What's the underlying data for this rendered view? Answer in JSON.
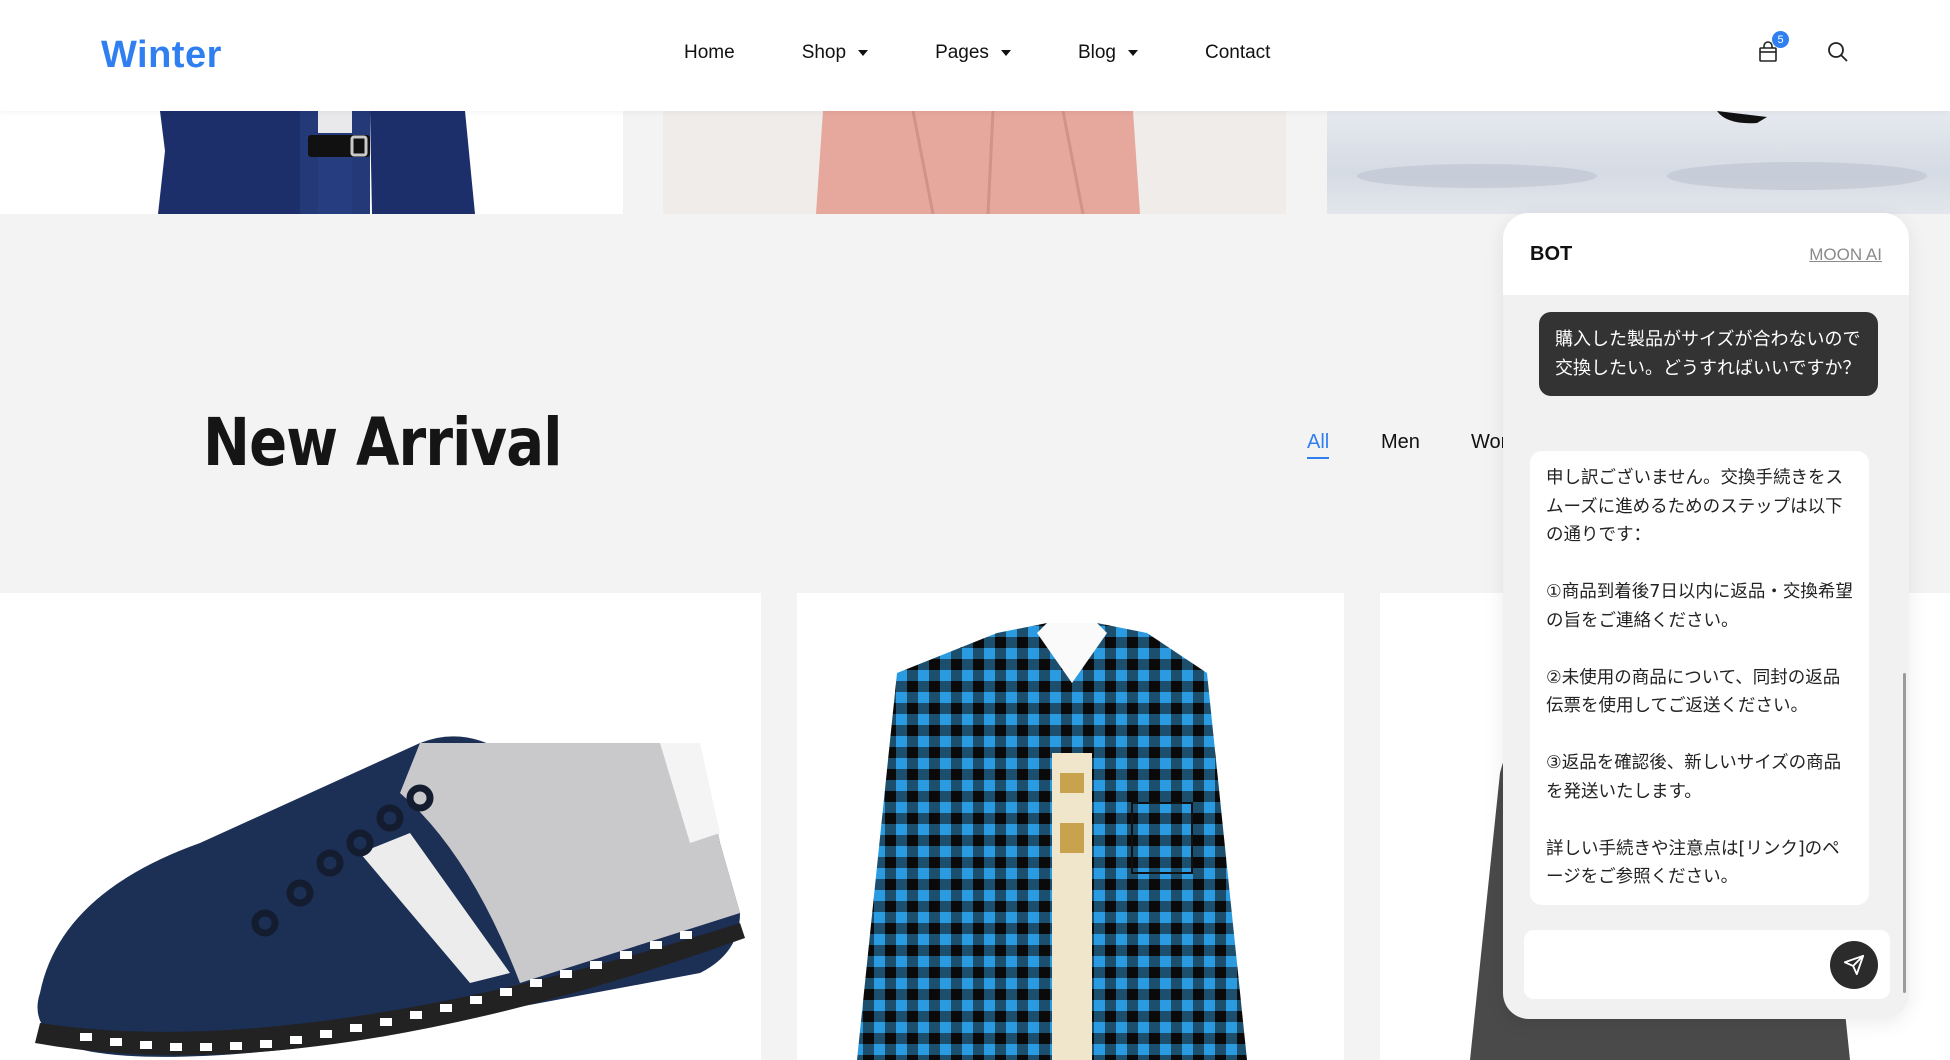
{
  "header": {
    "logo": "Winter",
    "nav": [
      {
        "label": "Home",
        "has_dropdown": false
      },
      {
        "label": "Shop",
        "has_dropdown": true
      },
      {
        "label": "Pages",
        "has_dropdown": true
      },
      {
        "label": "Blog",
        "has_dropdown": true
      },
      {
        "label": "Contact",
        "has_dropdown": false
      }
    ],
    "cart_count": "5",
    "icons": {
      "cart": "shopping-bag-icon",
      "search": "search-icon"
    }
  },
  "section": {
    "title": "New Arrival",
    "filters": [
      {
        "label": "All",
        "active": true
      },
      {
        "label": "Men",
        "active": false
      },
      {
        "label": "Wor",
        "active": false
      }
    ]
  },
  "chat": {
    "title": "BOT",
    "link": "MOON AI",
    "user_message": "購入した製品がサイズが合わないので交換したい。どうすればいいですか？",
    "bot_message": [
      "申し訳ございません。交換手続きをスムーズに進めるためのステップは以下の通りです：",
      "①商品到着後7日以内に返品・交換希望の旨をご連絡ください。",
      "②未使用の商品について、同封の返品伝票を使用してご返送ください。",
      "③返品を確認後、新しいサイズの商品を発送いたします。",
      "詳しい手続きや注意点は[リンク]のページをご参照ください。"
    ],
    "input_value": "",
    "send_icon": "send-icon"
  },
  "colors": {
    "accent": "#2f7ff0",
    "page_bg": "#f3f3f3",
    "user_bubble": "#333333",
    "send_button": "#2b2b2b"
  }
}
